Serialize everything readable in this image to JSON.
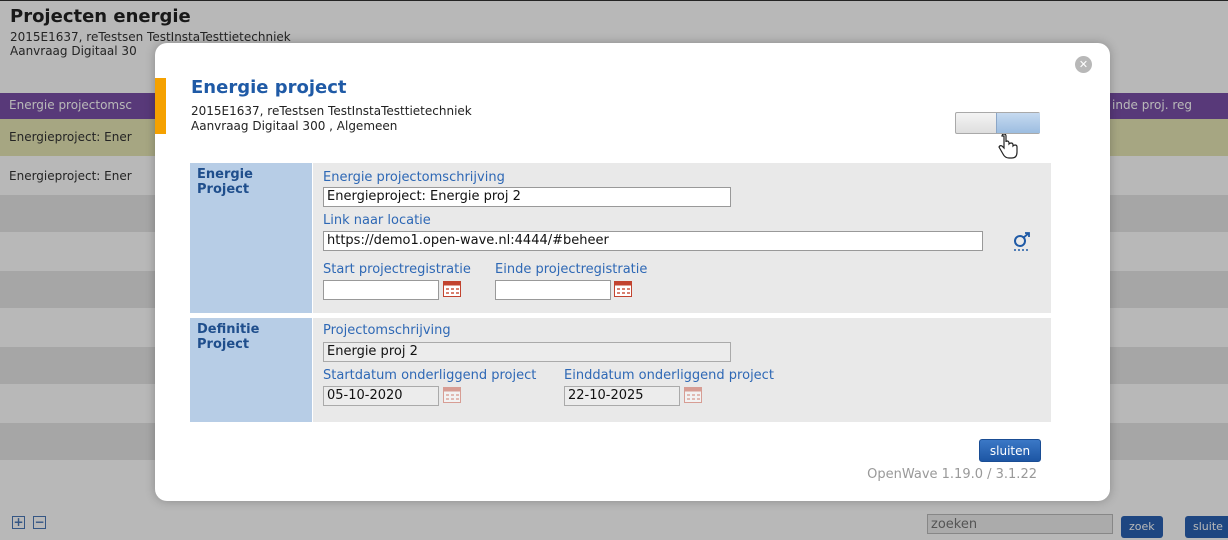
{
  "background": {
    "title": "Projecten energie",
    "subtitle_line1": "2015E1637, reTestsen TestInstaTesttietechniek",
    "subtitle_line2": "Aanvraag Digitaal 30",
    "column_left": "Energie projectomsc",
    "column_right": "inde proj. reg",
    "rows": [
      "Energieproject: Ener",
      "Energieproject: Ener"
    ],
    "search_placeholder": "zoeken",
    "zoek_label": "zoek",
    "sluiten_label": "sluite",
    "colors": {
      "header": "#7b4fa8",
      "selected_row": "#e6e6b4",
      "gray_row": "#e6e6e6"
    }
  },
  "modal": {
    "title": "Energie project",
    "subtitle_line1": "2015E1637, reTestsen TestInstaTesttietechniek",
    "subtitle_line2": "Aanvraag Digitaal 300 , Algemeen",
    "section1": {
      "label_line1": "Energie",
      "label_line2": "Project",
      "omschrijving_label": "Energie projectomschrijving",
      "omschrijving_value": "Energieproject: Energie proj 2",
      "link_label": "Link naar locatie",
      "link_value": "https://demo1.open-wave.nl:4444/#beheer",
      "start_label": "Start projectregistratie",
      "start_value": "",
      "einde_label": "Einde projectregistratie",
      "einde_value": ""
    },
    "section2": {
      "label_line1": "Definitie",
      "label_line2": "Project",
      "omschrijving_label": "Projectomschrijving",
      "omschrijving_value": "Energie proj 2",
      "startdatum_label": "Startdatum onderliggend project",
      "startdatum_value": "05-10-2020",
      "einddatum_label": "Einddatum onderliggend project",
      "einddatum_value": "22-10-2025"
    },
    "sluiten_label": "sluiten",
    "version": "OpenWave 1.19.0 / 3.1.22",
    "colors": {
      "accent": "#f5a100",
      "title": "#1f5aa6",
      "section_label_bg": "#b7cde6",
      "section_body_bg": "#e9e9e9"
    },
    "icons": {
      "close": "close-icon",
      "calendar": "calendar-icon",
      "link": "open-link-icon",
      "cursor": "hand-cursor-icon"
    }
  }
}
